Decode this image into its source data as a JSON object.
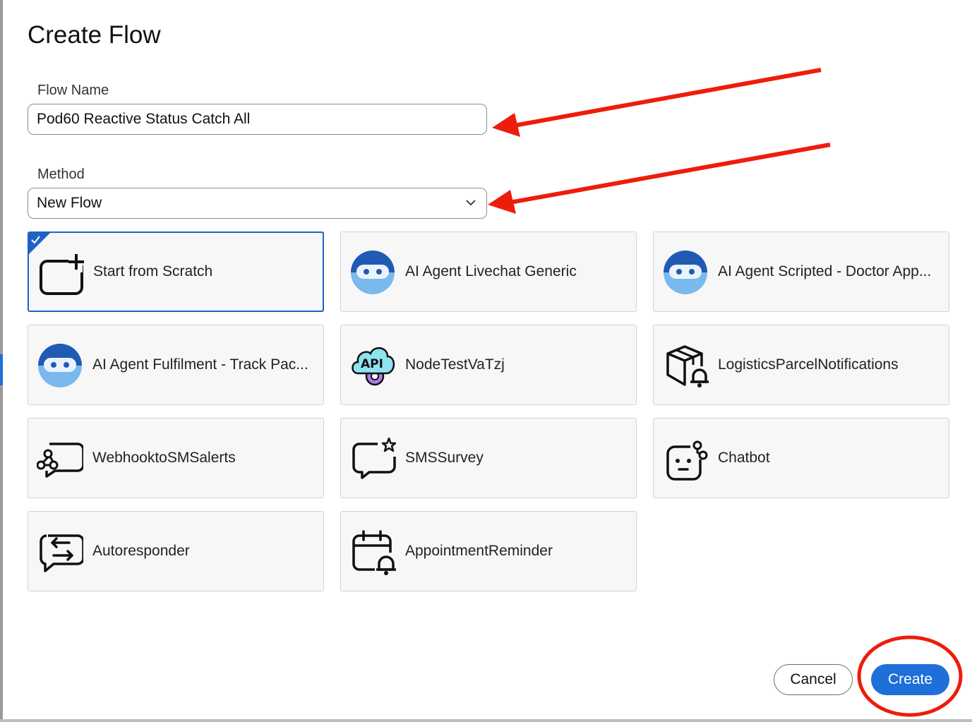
{
  "dialog": {
    "title": "Create Flow"
  },
  "flow_name": {
    "label": "Flow Name",
    "value": "Pod60 Reactive Status Catch All"
  },
  "method": {
    "label": "Method",
    "value": "New Flow"
  },
  "templates": [
    {
      "name": "Start from Scratch",
      "icon": "add-canvas-icon",
      "selected": true
    },
    {
      "name": "AI Agent Livechat Generic",
      "icon": "ai-agent-icon"
    },
    {
      "name": "AI Agent Scripted - Doctor App...",
      "icon": "ai-agent-icon"
    },
    {
      "name": "AI Agent Fulfilment - Track Pac...",
      "icon": "ai-agent-icon"
    },
    {
      "name": "NodeTestVaTzj",
      "icon": "api-cloud-icon"
    },
    {
      "name": "LogisticsParcelNotifications",
      "icon": "parcel-bell-icon"
    },
    {
      "name": "WebhooktoSMSalerts",
      "icon": "webhook-chat-icon"
    },
    {
      "name": "SMSSurvey",
      "icon": "chat-star-icon"
    },
    {
      "name": "Chatbot",
      "icon": "bot-icon"
    },
    {
      "name": "Autoresponder",
      "icon": "chat-exchange-icon"
    },
    {
      "name": "AppointmentReminder",
      "icon": "calendar-bell-icon"
    }
  ],
  "buttons": {
    "cancel": "Cancel",
    "create": "Create"
  },
  "colors": {
    "accent": "#1e6fd9",
    "annotation": "#ee1c0c",
    "selected_border": "#1e63c4"
  }
}
